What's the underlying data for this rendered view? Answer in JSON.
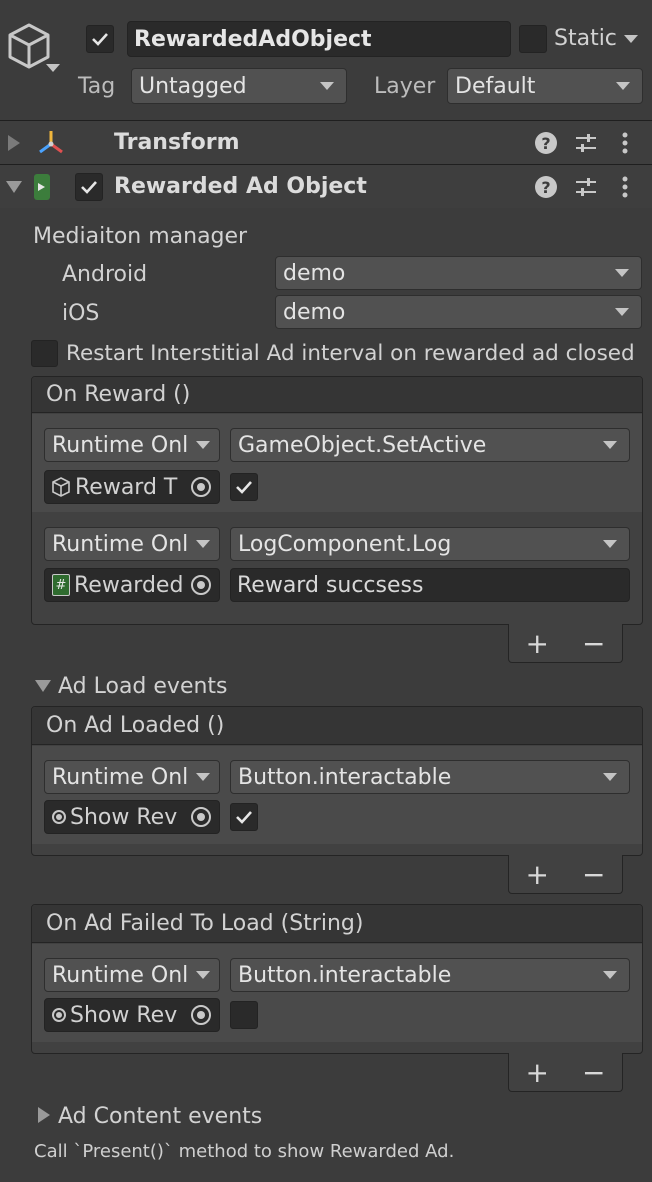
{
  "header": {
    "object_name": "RewardedAdObject",
    "static_label": "Static",
    "tag_label": "Tag",
    "tag_value": "Untagged",
    "layer_label": "Layer",
    "layer_value": "Default",
    "active": true,
    "static": false
  },
  "components": {
    "transform": {
      "title": "Transform"
    },
    "rewarded": {
      "title": "Rewarded Ad Object",
      "enabled": true
    }
  },
  "mediation": {
    "label": "Mediaiton manager",
    "android_label": "Android",
    "android_value": "demo",
    "ios_label": "iOS",
    "ios_value": "demo"
  },
  "restart_option": {
    "label": "Restart Interstitial Ad interval on rewarded ad closed",
    "checked": false
  },
  "on_reward": {
    "title": "On Reward ()",
    "listeners": [
      {
        "runtime": "Runtime Onl",
        "method": "GameObject.SetActive",
        "target": "Reward T",
        "target_icon": "cube-icon",
        "arg_type": "bool",
        "arg_checked": true
      },
      {
        "runtime": "Runtime Onl",
        "method": "LogComponent.Log",
        "target": "Rewarded",
        "target_icon": "script-icon",
        "arg_type": "string",
        "arg_value": "Reward succsess"
      }
    ],
    "add_label": "+",
    "remove_label": "−"
  },
  "ad_load": {
    "label": "Ad Load events",
    "expanded": true,
    "on_loaded": {
      "title": "On Ad Loaded ()",
      "runtime": "Runtime Onl",
      "method": "Button.interactable",
      "target": "Show Rev",
      "target_icon": "button-icon",
      "arg_checked": true,
      "add_label": "+",
      "remove_label": "−"
    },
    "on_failed": {
      "title": "On Ad Failed To Load (String)",
      "runtime": "Runtime Onl",
      "method": "Button.interactable",
      "target": "Show Rev",
      "target_icon": "button-icon",
      "arg_checked": false,
      "add_label": "+",
      "remove_label": "−"
    }
  },
  "ad_content": {
    "label": "Ad Content events",
    "expanded": false
  },
  "help_text": "Call `Present()` method to show Rewarded Ad.",
  "colors": {
    "background": "#3c3c3c",
    "field": "#2a2a2a",
    "dropdown": "#515151",
    "text": "#d2d2d2"
  }
}
